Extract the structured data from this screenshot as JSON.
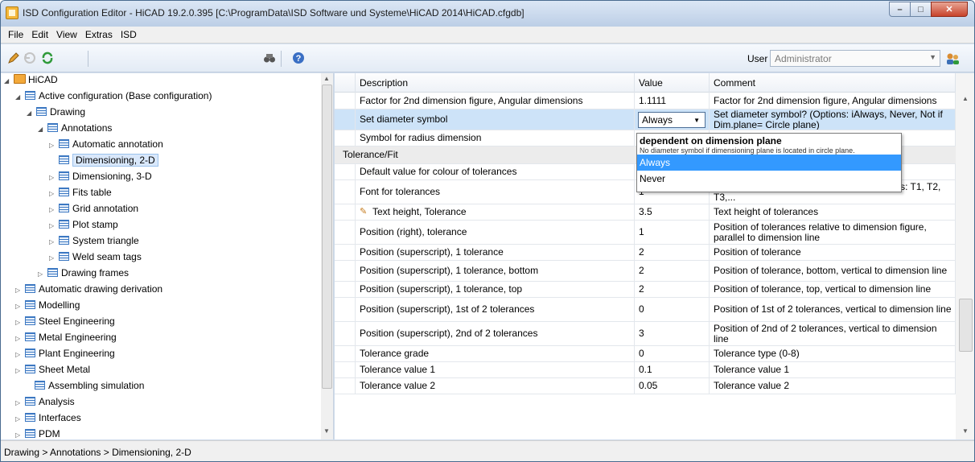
{
  "window": {
    "title": "ISD Configuration Editor  - HiCAD 19.2.0.395 [C:\\ProgramData\\ISD Software und Systeme\\HiCAD 2014\\HiCAD.cfgdb]",
    "min_label": "–",
    "max_label": "□",
    "close_label": "✕"
  },
  "menu": [
    "File",
    "Edit",
    "View",
    "Extras",
    "ISD"
  ],
  "toolbar": {
    "user_label": "User",
    "user_value": "Administrator",
    "icons": [
      "pencil-icon",
      "undo-icon",
      "refresh-icon",
      "binoculars-icon",
      "help-icon",
      "user-icon"
    ]
  },
  "tree": {
    "items": [
      {
        "label": "HiCAD",
        "arrow": "◢",
        "icon": "folder"
      },
      {
        "label": "Active configuration (Base configuration)",
        "arrow": "◢",
        "icon": "table"
      },
      {
        "label": "Drawing",
        "arrow": "◢",
        "icon": "table"
      },
      {
        "label": "Annotations",
        "arrow": "◢",
        "icon": "table"
      },
      {
        "label": "Automatic annotation",
        "arrow": "▷",
        "icon": "table"
      },
      {
        "label": "Dimensioning, 2-D",
        "arrow": "",
        "icon": "table",
        "selected": true
      },
      {
        "label": "Dimensioning, 3-D",
        "arrow": "▷",
        "icon": "table"
      },
      {
        "label": "Fits table",
        "arrow": "▷",
        "icon": "table"
      },
      {
        "label": "Grid annotation",
        "arrow": "▷",
        "icon": "table"
      },
      {
        "label": "Plot stamp",
        "arrow": "▷",
        "icon": "table"
      },
      {
        "label": "System triangle",
        "arrow": "▷",
        "icon": "table"
      },
      {
        "label": "Weld seam tags",
        "arrow": "▷",
        "icon": "table"
      },
      {
        "label": "Drawing frames",
        "arrow": "▷",
        "icon": "table"
      },
      {
        "label": "Automatic drawing derivation",
        "arrow": "▷",
        "icon": "table"
      },
      {
        "label": "Modelling",
        "arrow": "▷",
        "icon": "table"
      },
      {
        "label": "Steel Engineering",
        "arrow": "▷",
        "icon": "table"
      },
      {
        "label": "Metal Engineering",
        "arrow": "▷",
        "icon": "table"
      },
      {
        "label": "Plant Engineering",
        "arrow": "▷",
        "icon": "table"
      },
      {
        "label": "Sheet Metal",
        "arrow": "▷",
        "icon": "table"
      },
      {
        "label": "Assembling simulation",
        "arrow": "",
        "icon": "table"
      },
      {
        "label": "Analysis",
        "arrow": "▷",
        "icon": "table"
      },
      {
        "label": "Interfaces",
        "arrow": "▷",
        "icon": "table"
      },
      {
        "label": "PDM",
        "arrow": "▷",
        "icon": "table"
      }
    ]
  },
  "grid": {
    "columns": [
      "Description",
      "Value",
      "Comment"
    ],
    "rows": [
      {
        "desc": "Factor for 2nd dimension figure, Angular dimensions",
        "value": "1.1111",
        "comment": "Factor for 2nd dimension figure, Angular dimensions"
      },
      {
        "desc": "Set diameter symbol",
        "value": "Always",
        "comment": "Set diameter symbol?  (Options: iAlways, Never, Not if Dim.plane= Circle plane)",
        "selected": true
      },
      {
        "desc": "Symbol for radius dimension",
        "value": "",
        "comment": ""
      },
      {
        "desc": "Tolerance/Fit",
        "value": "",
        "comment": "",
        "section": true
      },
      {
        "desc": "Default value for colour of tolerances",
        "value": "",
        "comment": ""
      },
      {
        "desc": "Font for tolerances",
        "value": "1",
        "comment": "For HiCAD fonts: 1,2,3,... For TrueType fonts: T1, T2, T3,..."
      },
      {
        "desc": "Text height, Tolerance",
        "value": "3.5",
        "comment": "Text height of tolerances",
        "edited": true
      },
      {
        "desc": "Position (right), tolerance",
        "value": "1",
        "comment": "Position of tolerances relative to dimension figure, parallel to dimension line"
      },
      {
        "desc": "Position (superscript), 1 tolerance",
        "value": "2",
        "comment": "Position of tolerance"
      },
      {
        "desc": "Position (superscript), 1 tolerance, bottom",
        "value": "2",
        "comment": "Position of tolerance, bottom, vertical to dimension line"
      },
      {
        "desc": "Position (superscript), 1 tolerance, top",
        "value": "2",
        "comment": "Position of tolerance, top, vertical to dimension line"
      },
      {
        "desc": "Position (superscript), 1st of 2 tolerances",
        "value": "0",
        "comment": "Position of 1st of 2 tolerances, vertical to dimension line"
      },
      {
        "desc": "Position (superscript), 2nd of 2 tolerances",
        "value": "3",
        "comment": "Position of 2nd of 2 tolerances, vertical to dimension line"
      },
      {
        "desc": "Tolerance grade",
        "value": "0",
        "comment": "Tolerance type (0-8)"
      },
      {
        "desc": "Tolerance value 1",
        "value": "0.1",
        "comment": "Tolerance value 1"
      },
      {
        "desc": "Tolerance value 2",
        "value": "0.05",
        "comment": "Tolerance value 2"
      }
    ]
  },
  "dropdown": {
    "header": "dependent on dimension plane",
    "subtext": "No diameter symbol if dimensioning plane is located in circle plane.",
    "options": [
      "Always",
      "Never"
    ],
    "highlighted": "Always"
  },
  "status": {
    "breadcrumb": "Drawing > Annotations > Dimensioning, 2-D"
  }
}
